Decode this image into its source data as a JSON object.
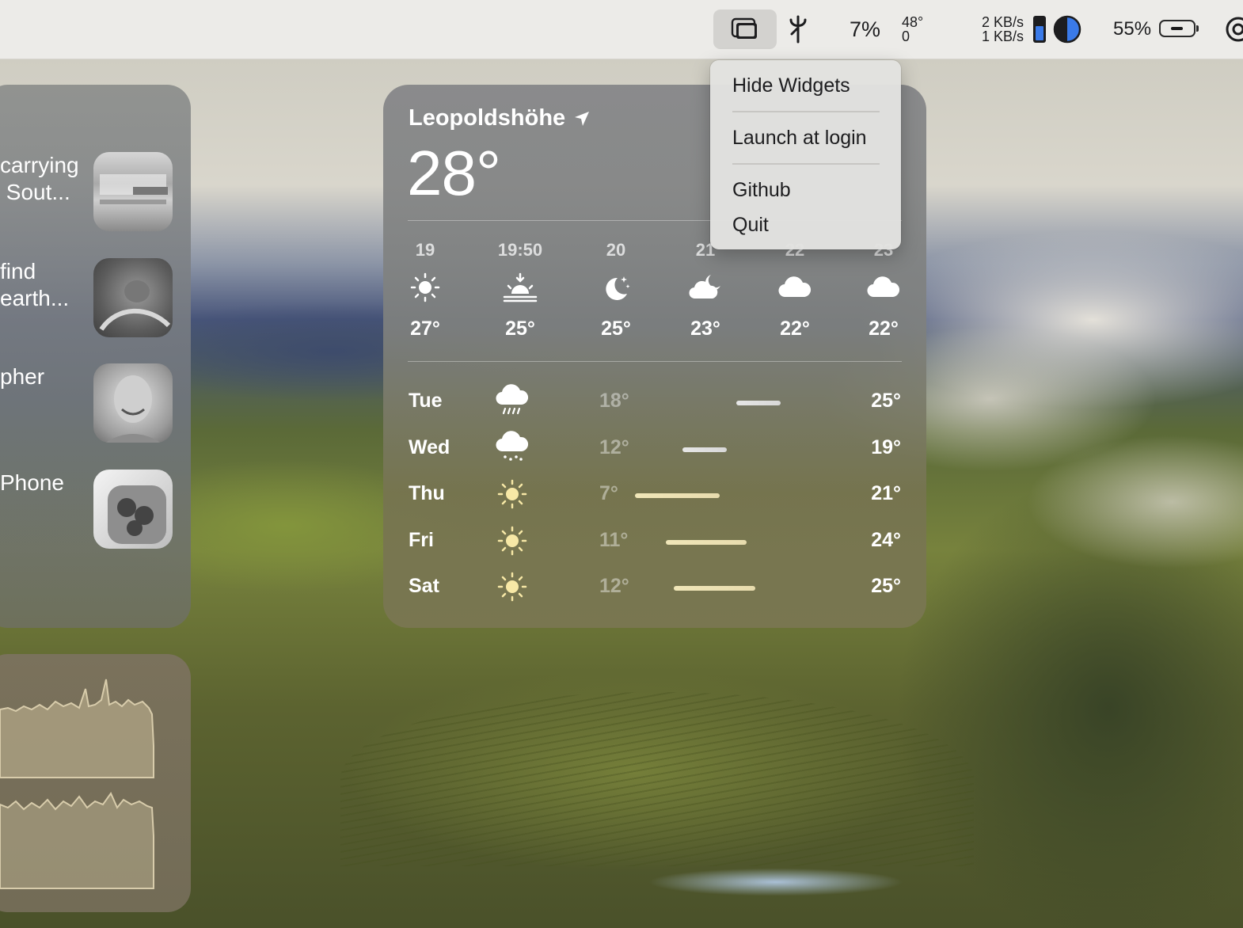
{
  "menubar": {
    "cpu_percent": "7%",
    "temp_top": "48°",
    "temp_bottom": "0",
    "net_up": "2 KB/s",
    "net_down": "1 KB/s",
    "battery_percent": "55%",
    "icons": [
      "widgets-window-icon",
      "fork-icon",
      "memory-bar-icon",
      "half-circle-icon",
      "battery-icon",
      "account-icon"
    ]
  },
  "menu": {
    "items": [
      "Hide Widgets",
      "Launch at login",
      "Github",
      "Quit"
    ]
  },
  "news": {
    "items": [
      {
        "text": "carrying\n Sout..."
      },
      {
        "text": "find\nearth..."
      },
      {
        "text": "pher"
      },
      {
        "text": "Phone"
      }
    ]
  },
  "weather": {
    "location": "Leopoldshöhe",
    "current_temp": "28°",
    "hourly": [
      {
        "time": "19",
        "icon": "sun-icon",
        "temp": "27°"
      },
      {
        "time": "19:50",
        "icon": "sunset-icon",
        "temp": "25°"
      },
      {
        "time": "20",
        "icon": "moon-stars-icon",
        "temp": "25°"
      },
      {
        "time": "21",
        "icon": "cloud-moon-icon",
        "temp": "23°"
      },
      {
        "time": "22",
        "icon": "cloud-icon",
        "temp": "22°"
      },
      {
        "time": "23",
        "icon": "cloud-icon",
        "temp": "22°"
      }
    ],
    "daily": [
      {
        "day": "Tue",
        "icon": "cloud-rain-icon",
        "low": "18°",
        "high": "25°",
        "range_start": 0.6,
        "range_end": 0.86
      },
      {
        "day": "Wed",
        "icon": "cloud-drizzle-icon",
        "low": "12°",
        "high": "19°",
        "range_start": 0.28,
        "range_end": 0.54
      },
      {
        "day": "Thu",
        "icon": "sun-icon",
        "low": "7°",
        "high": "21°",
        "range_start": 0.0,
        "range_end": 0.5
      },
      {
        "day": "Fri",
        "icon": "sun-icon",
        "low": "11°",
        "high": "24°",
        "range_start": 0.18,
        "range_end": 0.66
      },
      {
        "day": "Sat",
        "icon": "sun-icon",
        "low": "12°",
        "high": "25°",
        "range_start": 0.23,
        "range_end": 0.71
      }
    ]
  }
}
